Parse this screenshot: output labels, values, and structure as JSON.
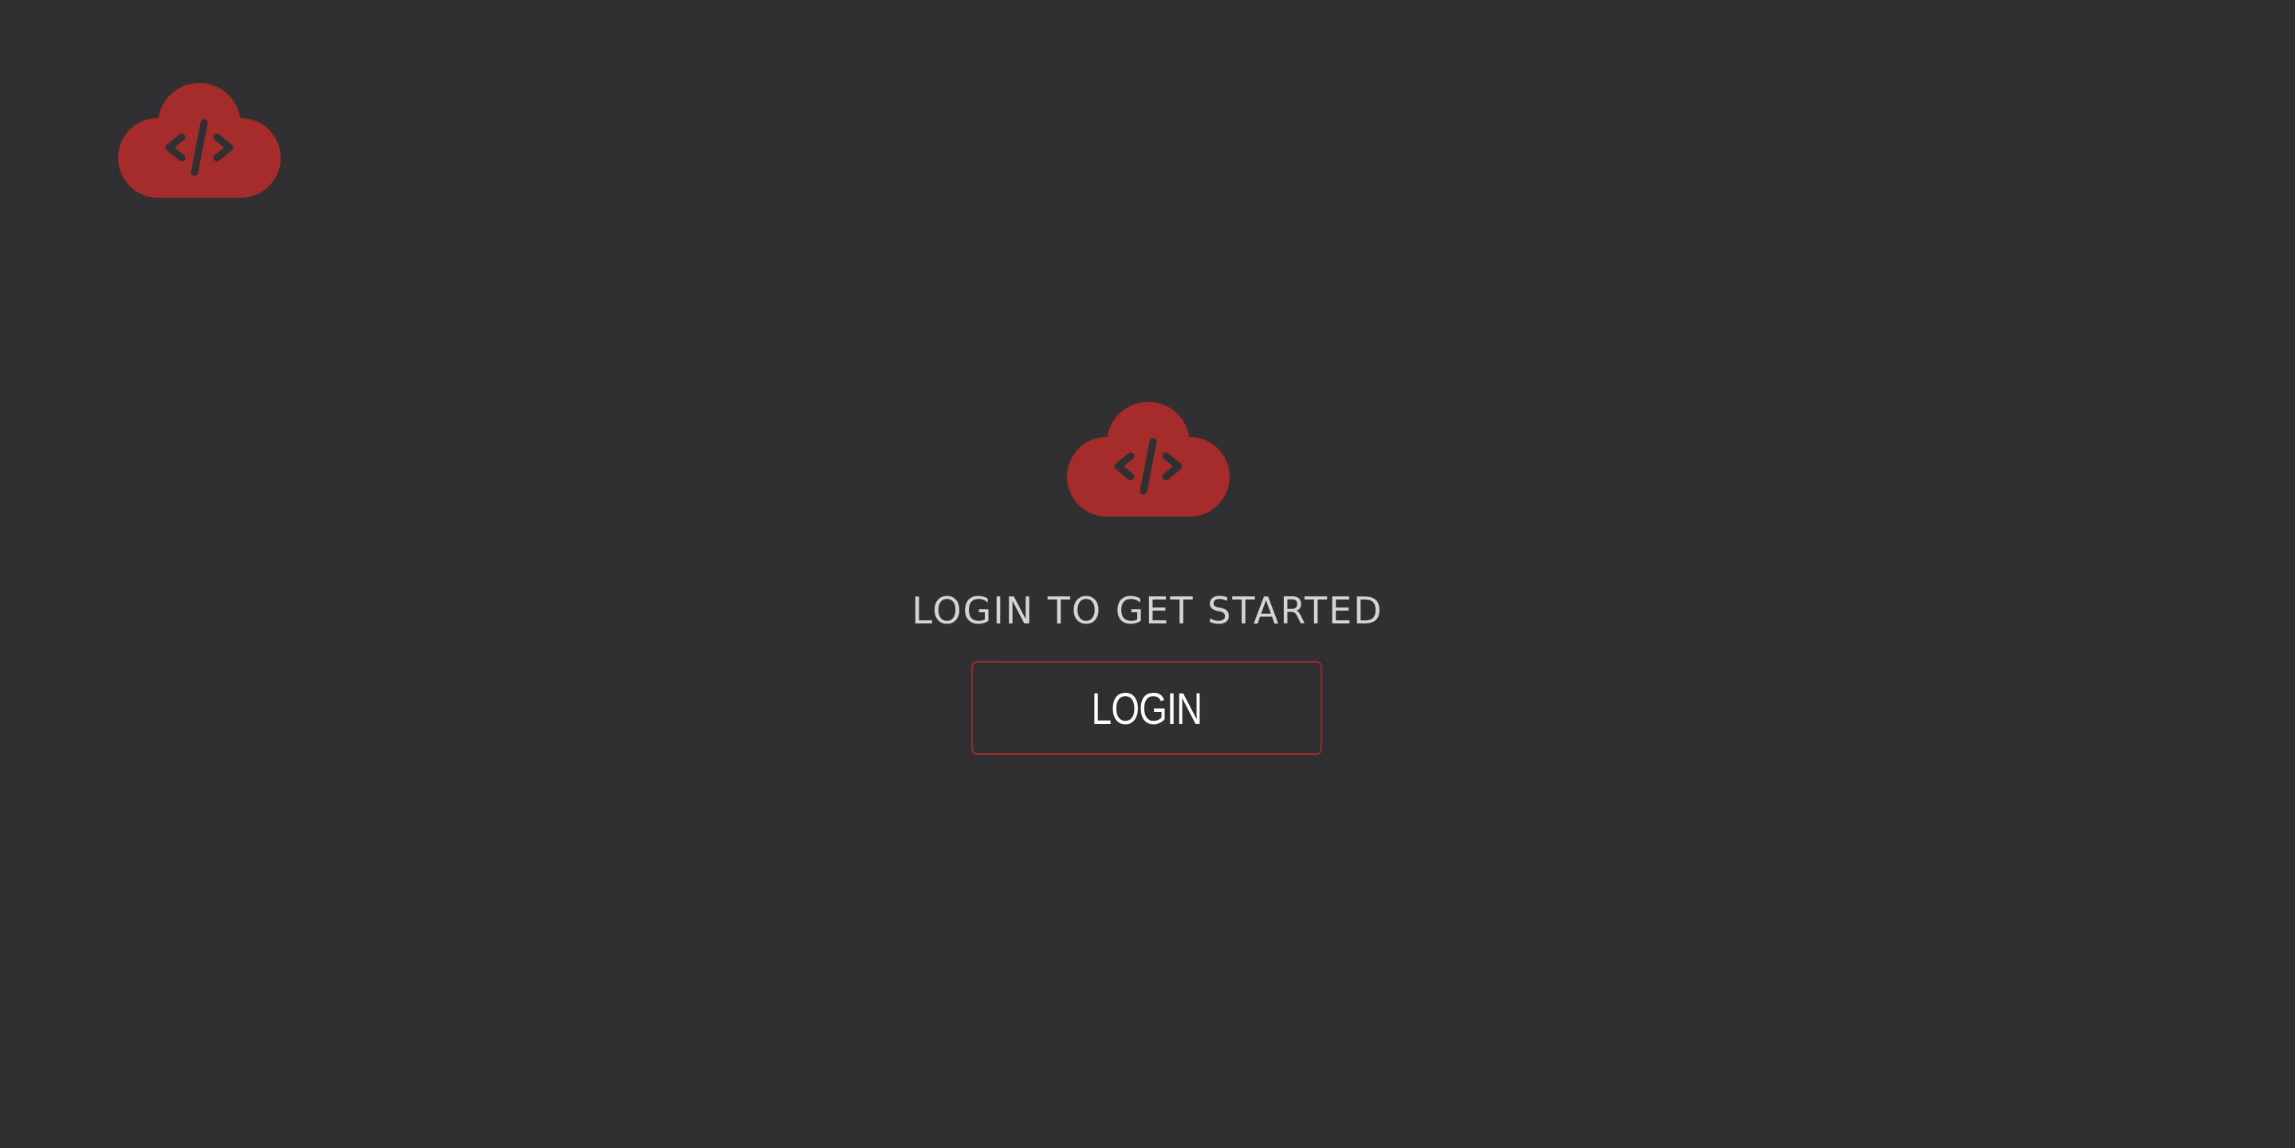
{
  "header": {
    "logo_icon": "cloud-code-icon"
  },
  "hero": {
    "logo_icon": "cloud-code-icon",
    "heading": "LOGIN TO GET STARTED",
    "login_label": "LOGIN"
  },
  "colors": {
    "background": "#303033",
    "brand_red": "#a52c2a",
    "heading_text": "#d4d4d6",
    "button_text": "#ffffff"
  }
}
